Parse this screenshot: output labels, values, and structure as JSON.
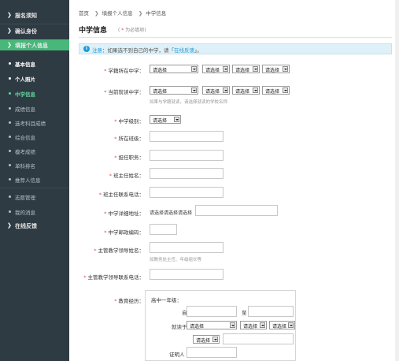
{
  "sidebar": {
    "top_items": [
      {
        "label": "报名须知"
      },
      {
        "label": "确认身份"
      },
      {
        "label": "填报个人信息"
      }
    ],
    "sub_items": [
      {
        "label": "基本信息"
      },
      {
        "label": "个人照片"
      },
      {
        "label": "中学信息"
      },
      {
        "label": "成绩信息"
      },
      {
        "label": "选考科目成绩"
      },
      {
        "label": "综合信息"
      },
      {
        "label": "模考成绩"
      },
      {
        "label": "单科排名"
      },
      {
        "label": "推荐人信息"
      }
    ],
    "bottom_items": [
      {
        "label": "志愿管理"
      },
      {
        "label": "我的消息"
      },
      {
        "label": "在线反馈"
      }
    ]
  },
  "breadcrumb": [
    "首页",
    "填报个人信息",
    "中学信息"
  ],
  "page": {
    "title": "中学信息",
    "required_note": "为必填项"
  },
  "notice": {
    "prefix": "注意",
    "text": "：如果选不到自己的中学，请「",
    "link": "在线反馈",
    "suffix": "」。"
  },
  "form": {
    "school_location": {
      "label": "学籍所在中学：",
      "selects": [
        "请选择",
        "请选择",
        "请选择",
        "请选择"
      ]
    },
    "current_school": {
      "label": "当前就读中学：",
      "selects": [
        "请选择",
        "请选择",
        "请选择",
        "请选择"
      ],
      "hint": "如果与学籍就读，请选择就读的学校名称"
    },
    "school_level": {
      "label": "中学级别：",
      "select": "请选择"
    },
    "class": {
      "label": "所在班级：",
      "value": ""
    },
    "position": {
      "label": "担任职务：",
      "value": ""
    },
    "teacher_name": {
      "label": "班主任姓名：",
      "value": ""
    },
    "teacher_phone": {
      "label": "班主任联系电话：",
      "value": ""
    },
    "school_address": {
      "label": "中学详细地址：",
      "value": "请选择请选择请选择"
    },
    "postal_code": {
      "label": "中学邮政编码：",
      "value": ""
    },
    "leader_name": {
      "label": "主管教学领导姓名：",
      "value": "",
      "hint": "如教务处主任、年级组长等"
    },
    "leader_phone": {
      "label": "主管教学领导联系电话：",
      "value": ""
    },
    "education": {
      "label": "教育经历：",
      "grade": "高中一年级：",
      "from": "自",
      "to": "至",
      "school_label": "就读于",
      "selects": [
        "请选择",
        "请选择",
        "请选择",
        "请选择"
      ],
      "witness": "证明人"
    }
  }
}
